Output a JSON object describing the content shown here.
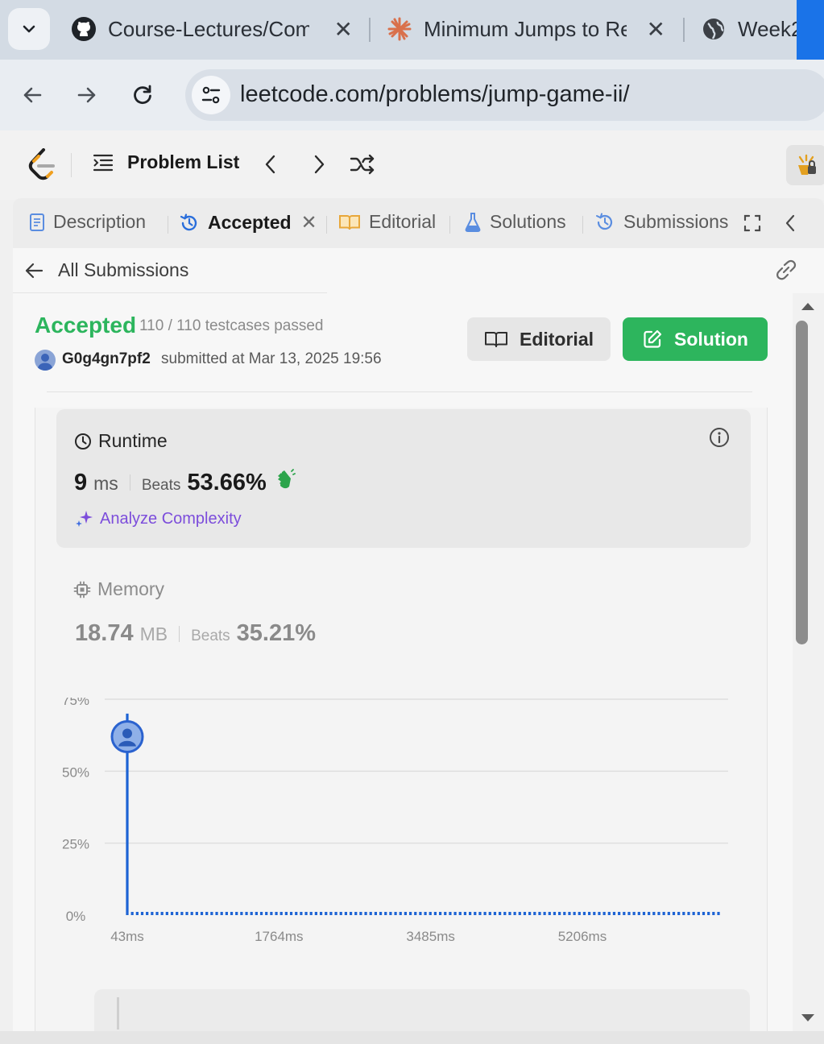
{
  "browser": {
    "tabs": [
      {
        "title": "Course-Lectures/Comp",
        "icon": "github-icon"
      },
      {
        "title": "Minimum Jumps to Rea",
        "icon": "claude-sunburst-icon"
      },
      {
        "title": "Week2",
        "icon": "globe-icon"
      }
    ],
    "url": "leetcode.com/problems/jump-game-ii/",
    "accent": "#1a73e8"
  },
  "lc_nav": {
    "problem_list": "Problem List"
  },
  "panel_tabs": {
    "description": "Description",
    "accepted": "Accepted",
    "editorial": "Editorial",
    "solutions": "Solutions",
    "submissions": "Submissions"
  },
  "subbar": {
    "all_submissions": "All Submissions"
  },
  "submission": {
    "status": "Accepted",
    "testcases": "110 / 110 testcases passed",
    "username": "G0g4gn7pf2",
    "submitted_at": "submitted at Mar 13, 2025 19:56",
    "editorial_btn": "Editorial",
    "solution_btn": "Solution",
    "status_color": "#2cb55d"
  },
  "runtime": {
    "title": "Runtime",
    "value": "9",
    "unit": "ms",
    "beats_label": "Beats",
    "beats": "53.66%",
    "analyze": "Analyze Complexity"
  },
  "memory": {
    "title": "Memory",
    "value": "18.74",
    "unit": "MB",
    "beats_label": "Beats",
    "beats": "35.21%"
  },
  "chart_data": {
    "type": "bar",
    "x_tick_labels": [
      "43ms",
      "1764ms",
      "3485ms",
      "5206ms"
    ],
    "y_tick_labels": [
      "75%",
      "50%",
      "25%",
      "0%"
    ],
    "ylim": [
      0,
      75
    ],
    "highlight": {
      "x_label": "43ms",
      "value": 62
    },
    "series": [
      {
        "values": [
          70,
          1,
          1,
          1,
          1,
          1,
          1,
          1,
          1,
          1,
          1,
          1,
          1,
          1,
          1,
          1,
          1,
          1,
          1,
          1,
          1,
          1,
          1,
          1,
          1,
          1,
          1,
          1,
          1,
          1,
          1,
          1,
          1,
          1,
          1,
          1,
          1,
          1,
          1,
          1,
          1,
          1,
          1,
          1,
          1,
          1,
          1,
          1,
          1,
          1,
          1,
          1,
          1,
          1,
          1,
          1,
          1,
          1,
          1,
          1,
          1,
          1,
          1,
          1,
          1,
          1,
          1,
          1,
          1,
          1,
          1,
          1,
          1,
          1,
          1,
          1,
          1,
          1,
          1,
          1,
          1,
          1,
          1,
          1,
          1,
          1,
          1,
          1,
          1,
          1,
          1,
          1,
          1,
          1,
          1,
          1,
          1,
          1,
          1,
          1,
          1,
          1,
          1,
          1,
          1,
          1,
          1,
          1,
          1,
          1,
          1,
          1,
          1,
          1,
          1,
          1,
          1,
          1,
          1,
          1
        ]
      }
    ],
    "bar_color": "#1d63d4"
  }
}
